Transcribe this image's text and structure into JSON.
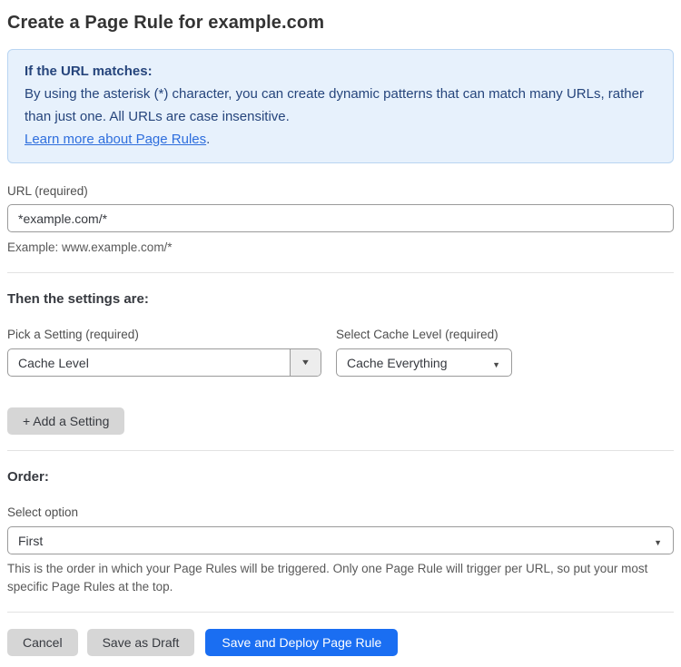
{
  "page": {
    "title": "Create a Page Rule for example.com"
  },
  "info_box": {
    "heading": "If the URL matches:",
    "body": "By using the asterisk (*) character, you can create dynamic patterns that can match many URLs, rather than just one. All URLs are case insensitive.",
    "link_label": "Learn more about Page Rules",
    "link_suffix": "."
  },
  "url_field": {
    "label": "URL (required)",
    "value": "*example.com/*",
    "helper": "Example: www.example.com/*"
  },
  "settings": {
    "heading": "Then the settings are:",
    "setting_select": {
      "label": "Pick a Setting (required)",
      "value": "Cache Level"
    },
    "cache_level_select": {
      "label": "Select Cache Level (required)",
      "value": "Cache Everything"
    },
    "add_button_label": "+ Add a Setting"
  },
  "order": {
    "heading": "Order:",
    "label": "Select option",
    "value": "First",
    "helper": "This is the order in which your Page Rules will be triggered. Only one Page Rule will trigger per URL, so put your most specific Page Rules at the top."
  },
  "actions": {
    "cancel_label": "Cancel",
    "save_draft_label": "Save as Draft",
    "save_deploy_label": "Save and Deploy Page Rule"
  },
  "icons": {
    "dropdown_arrow": "▼"
  },
  "colors": {
    "accent_blue": "#1a6ef2",
    "info_background": "#e7f1fc",
    "info_border": "#b9d5f2",
    "info_text": "#26457c",
    "link_blue": "#2e6edd",
    "button_gray": "#d6d6d6"
  }
}
